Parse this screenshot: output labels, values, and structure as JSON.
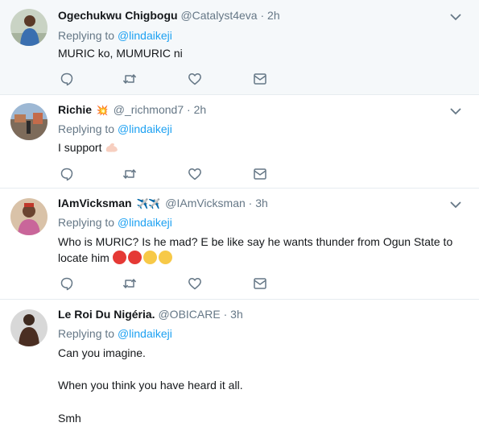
{
  "colors": {
    "link": "#1da1f2",
    "muted": "#657786",
    "text": "#14171a",
    "highlight_bg": "#f5f8fa",
    "divider": "#e6ecf0"
  },
  "tweets": [
    {
      "name": "Ogechukwu Chigbogu",
      "handle": "@Catalyst4eva",
      "dot": "·",
      "time": "2h",
      "reply_prefix": "Replying to",
      "reply_to": "@lindaikeji",
      "text": "MURIC ko, MUMURIC ni"
    },
    {
      "name": "Richie",
      "badge": "💥",
      "handle": "@_richmond7",
      "dot": "·",
      "time": "2h",
      "reply_prefix": "Replying to",
      "reply_to": "@lindaikeji",
      "text": "I support",
      "text_emoji": "flexed-biceps"
    },
    {
      "name": "IAmVicksman",
      "badge": "✈️✈️",
      "handle": "@IAmVicksman",
      "dot": "·",
      "time": "3h",
      "reply_prefix": "Replying to",
      "reply_to": "@lindaikeji",
      "text_line1": "Who is MURIC? Is he mad? E be like say he wants thunder from Ogun State to",
      "text_line2": "locate him",
      "text_emojis": [
        "angry-face",
        "angry-face",
        "eye-roll-face",
        "eye-roll-face"
      ]
    },
    {
      "name": "Le Roi Du Nigéria.",
      "handle": "@OBICARE",
      "dot": "·",
      "time": "3h",
      "reply_prefix": "Replying to",
      "reply_to": "@lindaikeji",
      "line1": "Can you imagine.",
      "line2": "When you think you have heard it all.",
      "line3": "Smh"
    }
  ],
  "icons": [
    "reply-icon",
    "retweet-icon",
    "like-icon",
    "message-icon",
    "chevron-down-icon"
  ]
}
